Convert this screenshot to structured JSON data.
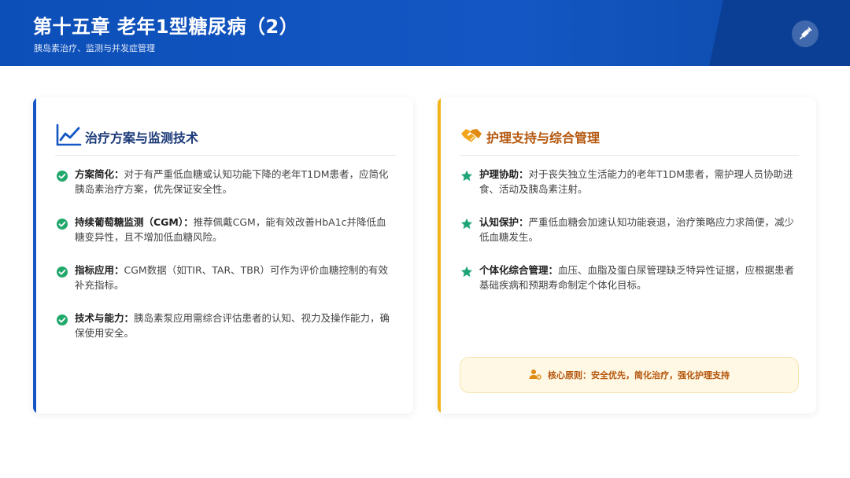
{
  "header": {
    "title": "第十五章 老年1型糖尿病（2）",
    "subtitle": "胰岛素治疗、监测与并发症管理",
    "badge_icon": "syringe-icon"
  },
  "left_card": {
    "title": "治疗方案与监测技术",
    "icon": "chart-line-icon",
    "accent_color": "#1457c4",
    "items": [
      {
        "label": "方案简化：",
        "text": "对于有严重低血糖或认知功能下降的老年T1DM患者，应简化胰岛素治疗方案，优先保证安全性。"
      },
      {
        "label": "持续葡萄糖监测（CGM）：",
        "text": "推荐佩戴CGM，能有效改善HbA1c并降低血糖变异性，且不增加低血糖风险。"
      },
      {
        "label": "指标应用：",
        "text": "CGM数据（如TIR、TAR、TBR）可作为评价血糖控制的有效补充指标。"
      },
      {
        "label": "技术与能力：",
        "text": "胰岛素泵应用需综合评估患者的认知、视力及操作能力，确保使用安全。"
      }
    ]
  },
  "right_card": {
    "title": "护理支持与综合管理",
    "icon": "handshake-icon",
    "accent_color": "#f2b417",
    "items": [
      {
        "label": "护理协助：",
        "text": "对于丧失独立生活能力的老年T1DM患者，需护理人员协助进食、活动及胰岛素注射。"
      },
      {
        "label": "认知保护：",
        "text": "严重低血糖会加速认知功能衰退，治疗策略应力求简便，减少低血糖发生。"
      },
      {
        "label": "个体化综合管理：",
        "text": "血压、血脂及蛋白尿管理缺乏特异性证据，应根据患者基础疾病和预期寿命制定个体化目标。"
      }
    ],
    "principle": "核心原则：安全优先，简化治疗，强化护理支持"
  }
}
